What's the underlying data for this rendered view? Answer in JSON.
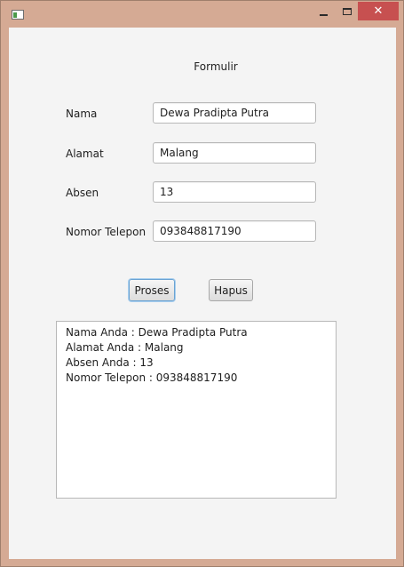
{
  "window": {
    "title": "",
    "close_glyph": "✕"
  },
  "form": {
    "title": "Formulir",
    "fields": [
      {
        "label": "Nama",
        "value": "Dewa Pradipta Putra"
      },
      {
        "label": "Alamat",
        "value": "Malang"
      },
      {
        "label": "Absen",
        "value": "13"
      },
      {
        "label": "Nomor Telepon",
        "value": "093848817190"
      }
    ],
    "buttons": {
      "proses": "Proses",
      "hapus": "Hapus"
    }
  },
  "output": {
    "lines": [
      "Nama Anda : Dewa Pradipta Putra",
      "Alamat Anda : Malang",
      "Absen Anda : 13",
      "Nomor Telepon : 093848817190"
    ]
  },
  "icons": {
    "app": "app-window-icon",
    "minimize": "minimize-icon",
    "maximize": "maximize-icon",
    "close": "close-icon"
  },
  "colors": {
    "frame": "#d5aa94",
    "close_button": "#c75050",
    "focus_border": "#6aa3d3"
  }
}
